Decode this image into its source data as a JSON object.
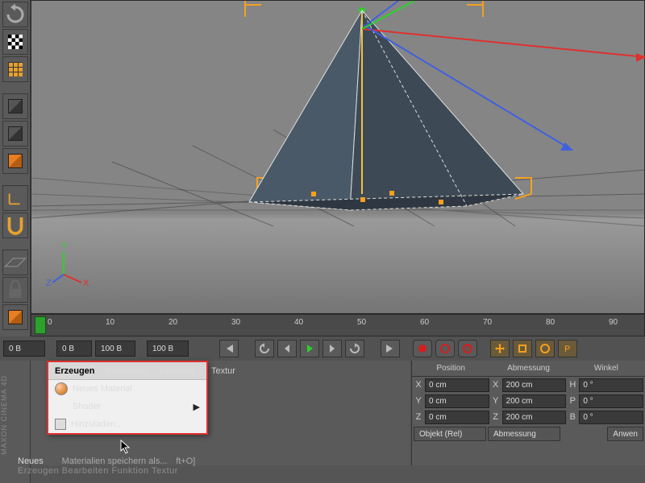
{
  "app_brand": "MAXON CINEMA 4D",
  "timeline": {
    "ticks": [
      "0",
      "10",
      "20",
      "30",
      "40",
      "50",
      "60",
      "70",
      "80",
      "90"
    ]
  },
  "playbar": {
    "start": "0 B",
    "mid_left": "0 B",
    "mid_right": "100 B",
    "end": "100 B"
  },
  "materials_menu": {
    "tabs": {
      "create": "Erzeugen",
      "edit": "Bearbeiten",
      "function": "Funktion"
    },
    "items": {
      "new_material": "Neues Material",
      "shader": "Shader",
      "append": "Hinzuladen..."
    }
  },
  "other_tab": "Textur",
  "below_menu": {
    "neues": "Neues",
    "save_materials": "Materialien speichern als...",
    "shortcut": "ft+O]",
    "faded": "Erzeugen   Bearbeiten   Funktion   Textur"
  },
  "coords": {
    "headers": {
      "pos": "Position",
      "size": "Abmessung",
      "angle": "Winkel"
    },
    "rows": [
      {
        "axis": "X",
        "pos": "0 cm",
        "size": "200 cm",
        "ang_label": "H",
        "ang": "0 °"
      },
      {
        "axis": "Y",
        "pos": "0 cm",
        "size": "200 cm",
        "ang_label": "P",
        "ang": "0 °"
      },
      {
        "axis": "Z",
        "pos": "0 cm",
        "size": "200 cm",
        "ang_label": "B",
        "ang": "0 °"
      }
    ],
    "mode": "Objekt (Rel)",
    "mode2": "Abmessung",
    "apply": "Anwen"
  },
  "viewport_axes": {
    "y": "Y",
    "x": "X",
    "z": "Z"
  },
  "colors": {
    "highlight": "#e03030",
    "accent_orange": "#e6a030",
    "accent_green": "#2dd02d",
    "accent_blue": "#4060e0",
    "accent_red": "#e03030"
  }
}
